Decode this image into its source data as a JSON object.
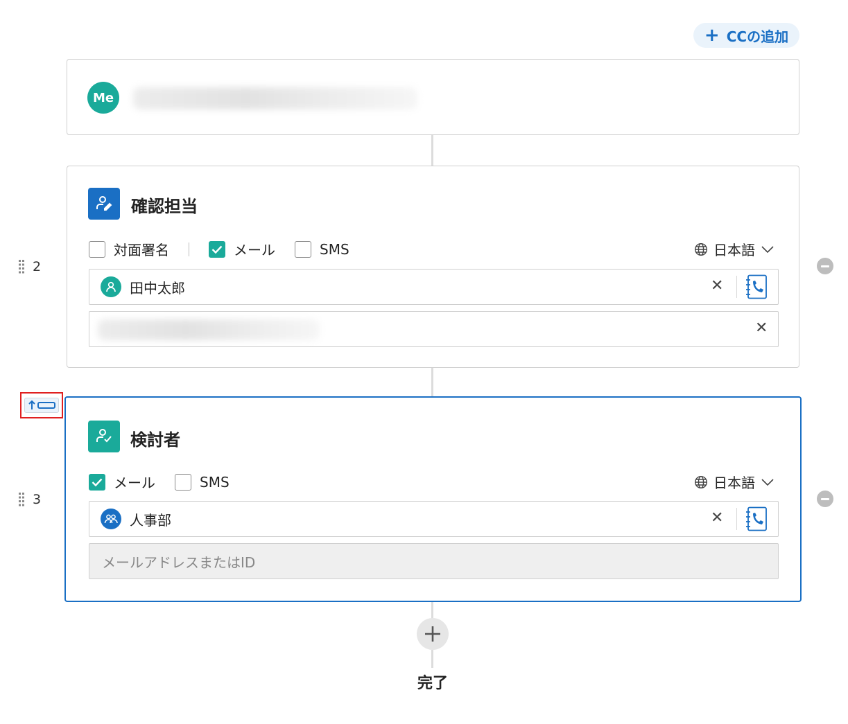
{
  "header": {
    "add_cc_label": "CCの追加"
  },
  "sender": {
    "avatar_label": "Me"
  },
  "steps": [
    {
      "order": "2",
      "role": "確認担当",
      "options": [
        {
          "label": "対面署名",
          "checked": false
        },
        {
          "label": "メール",
          "checked": true
        },
        {
          "label": "SMS",
          "checked": false
        }
      ],
      "language": "日本語",
      "recipient": {
        "name": "田中太郎",
        "type": "person"
      }
    },
    {
      "order": "3",
      "role": "検討者",
      "options": [
        {
          "label": "メール",
          "checked": true
        },
        {
          "label": "SMS",
          "checked": false
        }
      ],
      "language": "日本語",
      "recipient": {
        "name": "人事部",
        "type": "group"
      },
      "address_placeholder": "メールアドレスまたはID"
    }
  ],
  "footer": {
    "done_label": "完了"
  },
  "colors": {
    "accent_blue": "#1a6fc4",
    "teal": "#1aaa9a",
    "highlight_red": "#e02020"
  }
}
